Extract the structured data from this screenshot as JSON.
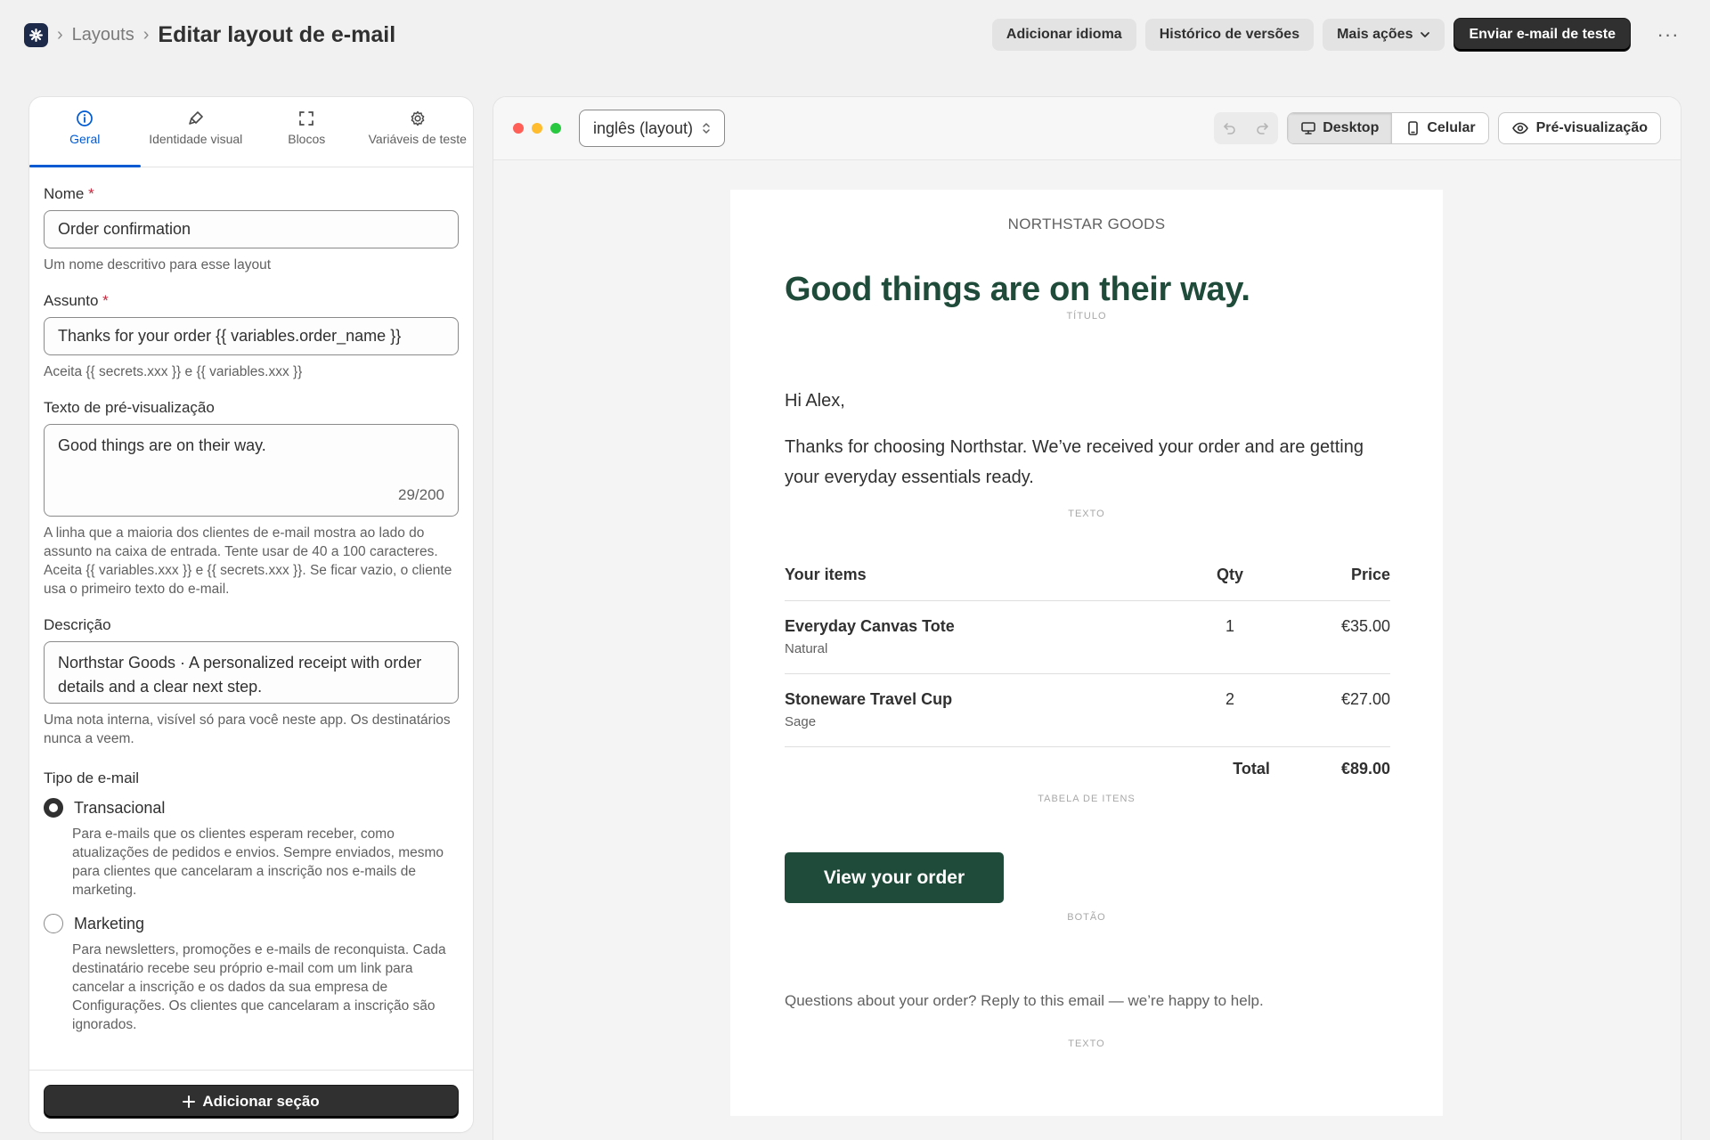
{
  "breadcrumb": {
    "parent": "Layouts",
    "title": "Editar layout de e-mail"
  },
  "header_actions": {
    "add_language": "Adicionar idioma",
    "version_history": "Histórico de versões",
    "more_actions": "Mais ações",
    "send_test": "Enviar e-mail de teste",
    "more_icon": "ellipsis-icon"
  },
  "tabs": [
    {
      "label": "Geral",
      "icon": "info-icon",
      "active": true
    },
    {
      "label": "Identidade visual",
      "icon": "paint-brush-icon",
      "active": false
    },
    {
      "label": "Blocos",
      "icon": "blocks-icon",
      "active": false
    },
    {
      "label": "Variáveis de teste",
      "icon": "gear-icon",
      "active": false
    }
  ],
  "form": {
    "name": {
      "label": "Nome",
      "required": "*",
      "value": "Order confirmation",
      "help": "Um nome descritivo para esse layout"
    },
    "subject": {
      "label": "Assunto",
      "required": "*",
      "value": "Thanks for your order {{ variables.order_name }}",
      "help": "Aceita {{ secrets.xxx }} e {{ variables.xxx }}"
    },
    "preview_text": {
      "label": "Texto de pré-visualização",
      "value": "Good things are on their way.",
      "counter": "29/200",
      "help": "A linha que a maioria dos clientes de e-mail mostra ao lado do assunto na caixa de entrada. Tente usar de 40 a 100 caracteres. Aceita {{ variables.xxx }} e {{ secrets.xxx }}. Se ficar vazio, o cliente usa o primeiro texto do e-mail."
    },
    "description": {
      "label": "Descrição",
      "value": "Northstar Goods · A personalized receipt with order details and a clear next step.",
      "help": "Uma nota interna, visível só para você neste app. Os destinatários nunca a veem."
    },
    "email_type": {
      "label": "Tipo de e-mail",
      "options": [
        {
          "label": "Transacional",
          "selected": true,
          "help": "Para e-mails que os clientes esperam receber, como atualizações de pedidos e envios. Sempre enviados, mesmo para clientes que cancelaram a inscrição nos e-mails de marketing."
        },
        {
          "label": "Marketing",
          "selected": false,
          "help": "Para newsletters, promoções e e-mails de reconquista. Cada destinatário recebe seu próprio e-mail com um link para cancelar a inscrição e os dados da sua empresa de Configurações. Os clientes que cancelaram a inscrição são ignorados."
        }
      ]
    },
    "add_section": "Adicionar seção"
  },
  "preview": {
    "language": "inglês (layout)",
    "views": [
      {
        "label": "Desktop",
        "active": true
      },
      {
        "label": "Celular",
        "active": false
      }
    ],
    "preview_button": "Pré-visualização"
  },
  "email": {
    "brand": "NORTHSTAR GOODS",
    "title": "Good things are on their way.",
    "title_tag": "TÍTULO",
    "greeting": "Hi Alex,",
    "body": "Thanks for choosing Northstar. We’ve received your order and are getting your everyday essentials ready.",
    "text_tag": "TEXTO",
    "items_header": {
      "item": "Your items",
      "qty": "Qty",
      "price": "Price"
    },
    "items": [
      {
        "name": "Everyday Canvas Tote",
        "variant": "Natural",
        "qty": "1",
        "price": "€35.00"
      },
      {
        "name": "Stoneware Travel Cup",
        "variant": "Sage",
        "qty": "2",
        "price": "€27.00"
      }
    ],
    "total_label": "Total",
    "total_value": "€89.00",
    "items_tag": "TABELA DE ITENS",
    "cta": "View your order",
    "cta_tag": "BOTÃO",
    "footer": "Questions about your order? Reply to this email — we’re happy to help.",
    "footer_tag": "TEXTO"
  },
  "colors": {
    "accent": "#005bd3",
    "email_green": "#1f4b3a",
    "dark_button": "#303030"
  }
}
